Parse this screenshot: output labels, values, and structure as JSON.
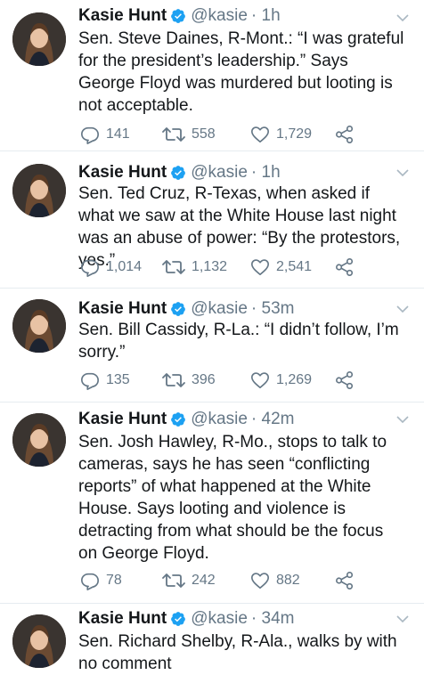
{
  "colors": {
    "text": "#14171a",
    "secondary": "#657786",
    "verified": "#1da1f2",
    "divider": "#e6ecf0"
  },
  "icons": {
    "reply": "reply-icon",
    "retweet": "retweet-icon",
    "like": "heart-icon",
    "share": "share-icon",
    "verified": "verified-badge-icon",
    "menu": "chevron-down-icon"
  },
  "tweets": [
    {
      "name": "Kasie Hunt",
      "handle": "@kasie",
      "time": "· 1h",
      "text": "Sen. Steve Daines, R-Mont.: “I was grateful for the president’s leadership.” Says George Floyd was murdered but looting is not acceptable.",
      "replies": "141",
      "retweets": "558",
      "likes": "1,729"
    },
    {
      "name": "Kasie Hunt",
      "handle": "@kasie",
      "time": "· 1h",
      "text": "Sen. Ted Cruz, R-Texas, when asked if what we saw at the White House last night was an abuse of power: “By the protestors, yes.”",
      "replies": "1,014",
      "retweets": "1,132",
      "likes": "2,541"
    },
    {
      "name": "Kasie Hunt",
      "handle": "@kasie",
      "time": "· 53m",
      "text": "Sen. Bill Cassidy, R-La.: “I didn’t follow, I’m sorry.”",
      "replies": "135",
      "retweets": "396",
      "likes": "1,269"
    },
    {
      "name": "Kasie Hunt",
      "handle": "@kasie",
      "time": "· 42m",
      "text": "Sen. Josh Hawley, R-Mo., stops to talk to cameras, says he has seen “conflicting reports” of what happened at the White House. Says looting and violence is detracting from what should be the focus on George Floyd.",
      "replies": "78",
      "retweets": "242",
      "likes": "882"
    },
    {
      "name": "Kasie Hunt",
      "handle": "@kasie",
      "time": "· 34m",
      "text": "Sen. Richard Shelby, R-Ala., walks by with no comment",
      "replies": "",
      "retweets": "",
      "likes": ""
    }
  ]
}
